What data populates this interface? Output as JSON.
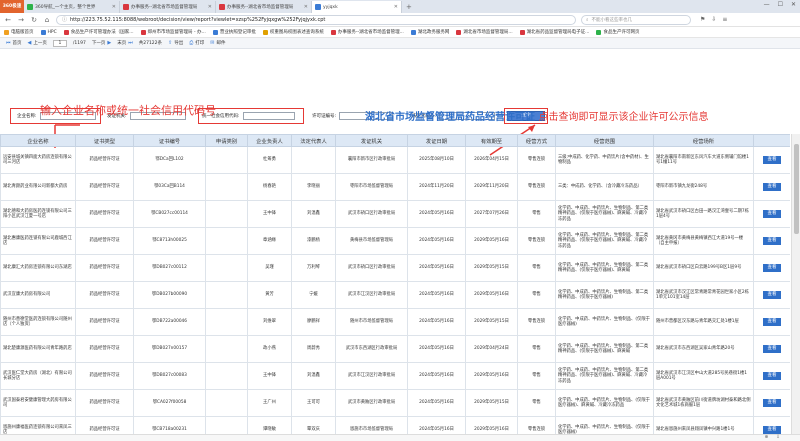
{
  "browser": {
    "app_logo": "360极速",
    "tabs": [
      {
        "label": "360导航_一个主页，整个世界",
        "color": "#2db24a"
      },
      {
        "label": "办事服务--湖北省市场监督管理局",
        "color": "#d9363e"
      },
      {
        "label": "办事服务--湖北省市场监督管理局",
        "color": "#d9363e"
      },
      {
        "label": "yyjqxk",
        "color": "#3a7bd5",
        "active": true
      }
    ],
    "url": "http://223.75.52.115:8088/webroot/decision/view/report?viewlet=xzsp%252Fyjqxgw%252Fyjqjyxk.cpt",
    "search_placeholder": "不能小看这些率也几",
    "bookmarks": [
      {
        "label": "电脑版首页",
        "color": "#f0a020"
      },
      {
        "label": "HPC",
        "color": "#3a7bd5"
      },
      {
        "label": "食品生产许可管理办法（国家...",
        "color": "#d9363e"
      },
      {
        "label": "郑州市市场监督管理局 - 办...",
        "color": "#d9363e"
      },
      {
        "label": "营业执照登记审批",
        "color": "#3a7bd5"
      },
      {
        "label": "权重图局权图表述查询系统",
        "color": "#e0a000"
      },
      {
        "label": "办事服务--湖北省市场监督管理...",
        "color": "#d9363e"
      },
      {
        "label": "湖北政务服务网",
        "color": "#3a7bd5"
      },
      {
        "label": "湖北省市场监督管理局...",
        "color": "#d9363e"
      },
      {
        "label": "湖北省药品监督管理局电子证...",
        "color": "#d9363e"
      },
      {
        "label": "食品生产许可网页",
        "color": "#2db24a"
      }
    ]
  },
  "toolbar": {
    "first": "首页",
    "prev": "上一页",
    "page": "1",
    "total_pages": "/1197",
    "next": "下一页",
    "last": "末页",
    "total_records": "共27122条",
    "export": "导出",
    "print": "打印",
    "email": "邮件"
  },
  "form": {
    "company_label": "企业名称:",
    "issuer_label": "发证机关:",
    "credit_label": "统一社会信用代码:",
    "license_label": "许可证编号:",
    "legal_label": "法定代表人:",
    "query_button": "查询"
  },
  "annotations": {
    "left": "输入企业名称或统一社会信用代码号",
    "right_blue": "湖北省市场监督管理局药品经营许可证",
    "right_red": "点击查询即可显示该企业许可公示信息"
  },
  "table": {
    "headers": [
      "企业名称",
      "证书类型",
      "证书编号",
      "申请类别",
      "企业负责人",
      "法定代表人",
      "发证机关",
      "发证日期",
      "有效期至",
      "经营方式",
      "经营范围",
      "经营场所",
      ""
    ],
    "view_label": "查看",
    "rows": [
      [
        "远安县城关镇四面大药房连锁有限公司三河店",
        "药品经营许可证",
        "鄂DCa回L102",
        "",
        "杜筹勇",
        "",
        "襄阳市新市区行政审批局",
        "2025年08月10日",
        "2026年04月15日",
        "零售连锁",
        "三级:中成药、化学药、中药饮片(含中药材)、生物制品",
        "湖北省襄阳市南新区东风汽车大道东侧辅门馆楼1号1幢11号"
      ],
      [
        "湖北青颜药业有限公司新都大药房",
        "药品经营许可证",
        "鄂03Ca回B114",
        "",
        "杨春艳",
        "李晓丽",
        "枣阳市市场监督管理局",
        "2024年11月20日",
        "2029年11月20日",
        "零售连锁",
        "三类：中成药、化学药、（含冷藏冷冻药品）",
        "枣阳市新市镇九龙街248号"
      ],
      [
        "湖北德和大药房医药连锁有限公司三阳小区武汉江夏一号店",
        "药品经营许可证",
        "鄂CB027cc00114",
        "",
        "王中锋",
        "刘温鑫",
        "武汉市硚口区行政审批局",
        "2024年05月16日",
        "2027年07月26日",
        "零售",
        "化学药、中成药、中药饮片、生物制品、第二类精神药品、(仅限于医疗器械)、麻黄碱、冷藏冷冻药品",
        "湖北省武汉市硚口区古田一路汉江湾壹号二期7栋1层4号"
      ],
      [
        "湖北惠康医药连锁有限公司鹿城西江店",
        "药品经营许可证",
        "鄂C8713h00025",
        "",
        "章涵缘",
        "漆鹏杨",
        "黄梅县市场监督管理局",
        "2024年05月16日",
        "2029年05月16日",
        "零售连锁",
        "化学药、中成药、中药饮片、生物制品、第二类精神药品、(仅限于医疗器械)、麻黄碱、冷藏冷冻药品",
        "湖北省黄冈市黄梅县黄梅镇西江大道19号一楼（自主申报）"
      ],
      [
        "湖北康汇大药房连锁有限公司东湖店",
        "药品经营许可证",
        "鄂DB027c00112",
        "",
        "吴瑾",
        "万利琴",
        "武汉市硚口区行政审批局",
        "2024年05月16日",
        "2029年05月15日",
        "零售",
        "化学药、中成药、中药饮片、生物制品、第二类精神药品、(仅限于医疗器械)、麻黄碱",
        "湖北省武汉市硚口区白云路199号B区1层9号"
      ],
      [
        "武汉宜康大药房有限公司",
        "药品经营许可证",
        "鄂DB027b00090",
        "",
        "黄芳",
        "宁媛",
        "武汉市江汉区行政审批局",
        "2024年05月16日",
        "2029年05月16日",
        "零售",
        "化学药、中成药、中药饮片、生物制品、第二类精神药品、(仅限于医疗器械)",
        "湖北省武汉市汉江区常青路常青花园世家小区2栋1单元101室14层"
      ],
      [
        "随州市善德堂医药连锁有限公司随州店（个人独资）",
        "药品经营许可证",
        "鄂DB722a00046",
        "",
        "刘维翠",
        "廖鹏祥",
        "随州市市场监督管理局",
        "2024年05月16日",
        "2029年05月15日",
        "零售连锁",
        "化学药、中成药、中药饮片、生物制品、(仅限于医疗器械)",
        "随州市曾都区汉东路与青年路交汇处1楼1层"
      ],
      [
        "湖北楚康源医药有限公司青年路药店",
        "药品经营许可证",
        "鄂DB027n00157",
        "",
        "政小燕",
        "周蔚秀",
        "武汉市东西湖区行政审批局",
        "2024年05月16日",
        "2029年04月24日",
        "零售",
        "化学药、中成药、中药饮片、生物制品、第二类精神药品、(仅限于医疗器械)、麻黄碱",
        "湖北省武汉市东西湖区吴家山青年路20号"
      ],
      [
        "武汉医仁堂大药房（湖北）有限公司长城分店",
        "药品经营许可证",
        "鄂DB027c00083",
        "",
        "王中锋",
        "刘温鑫",
        "武汉市江汉区行政审批局",
        "2024年05月16日",
        "2029年05月16日",
        "零售",
        "化学药、中成药、中药饮片、生物制品、第二类精神药品、(仅限于医疗器械)、麻黄碱、冷藏冷冻药品",
        "湖北省武汉市江汉区中山大道285号民巷街1楼1层A001号"
      ],
      [
        "武汉国泰君安健康管理大药房有限公司",
        "药品经营许可证",
        "鄂CA027f00058",
        "",
        "王广州",
        "王可可",
        "武汉市黄陂区行政审批局",
        "2024年05月16日",
        "2029年05月15日",
        "零售",
        "化学药、中成药、中药饮片、生物制品、(仅限于医疗器械)、麻黄碱、冷藏冷冻药品",
        "湖北省武汉市黄陂区前川街道牌坊湖村泰和路北侧文化艺术城1栋商服1层"
      ],
      [
        "恩施州康福医药连锁有限公司来凤三店",
        "药品经营许可证",
        "鄂CB718a00231",
        "",
        "谭晓敏",
        "覃双庆",
        "恩施市市场监督管理局",
        "2024年05月16日",
        "2029年05月16日",
        "零售连锁",
        "化学药、中成药、中药饮片、生物制品、(仅限于医疗器械)",
        "湖北省恩施州来凤县翔凤镇中兴路1楼1号"
      ]
    ]
  }
}
